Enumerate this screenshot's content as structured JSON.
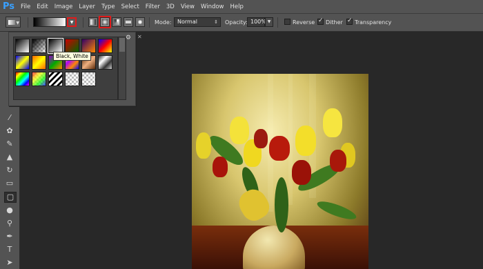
{
  "app": {
    "logo": "Ps"
  },
  "menu": [
    "File",
    "Edit",
    "Image",
    "Layer",
    "Type",
    "Select",
    "Filter",
    "3D",
    "View",
    "Window",
    "Help"
  ],
  "options": {
    "mode_label": "Mode:",
    "mode_value": "Normal",
    "opacity_label": "Opacity:",
    "opacity_value": "100%",
    "reverse_label": "Reverse",
    "reverse_checked": false,
    "dither_label": "Dither",
    "dither_checked": true,
    "transparency_label": "Transparency",
    "transparency_checked": true
  },
  "picker": {
    "tooltip": "Black, White",
    "presets": [
      "foreground-to-background",
      "foreground-to-transparent",
      "black-white",
      "red-green",
      "violet-orange",
      "blue-red-yellow",
      "blue-yellow-blue",
      "orange-yellow-orange",
      "violet-green-orange",
      "yellow-violet-orange-blue",
      "copper",
      "chrome",
      "spectrum",
      "transparent-rainbow",
      "transparent-stripes",
      "transparent-checker-1",
      "transparent-checker-2"
    ]
  },
  "tools": [
    "gradient-tool-icon"
  ],
  "colors": {
    "accent_highlight": "#e01a1a",
    "ps_blue": "#39a0ff"
  }
}
